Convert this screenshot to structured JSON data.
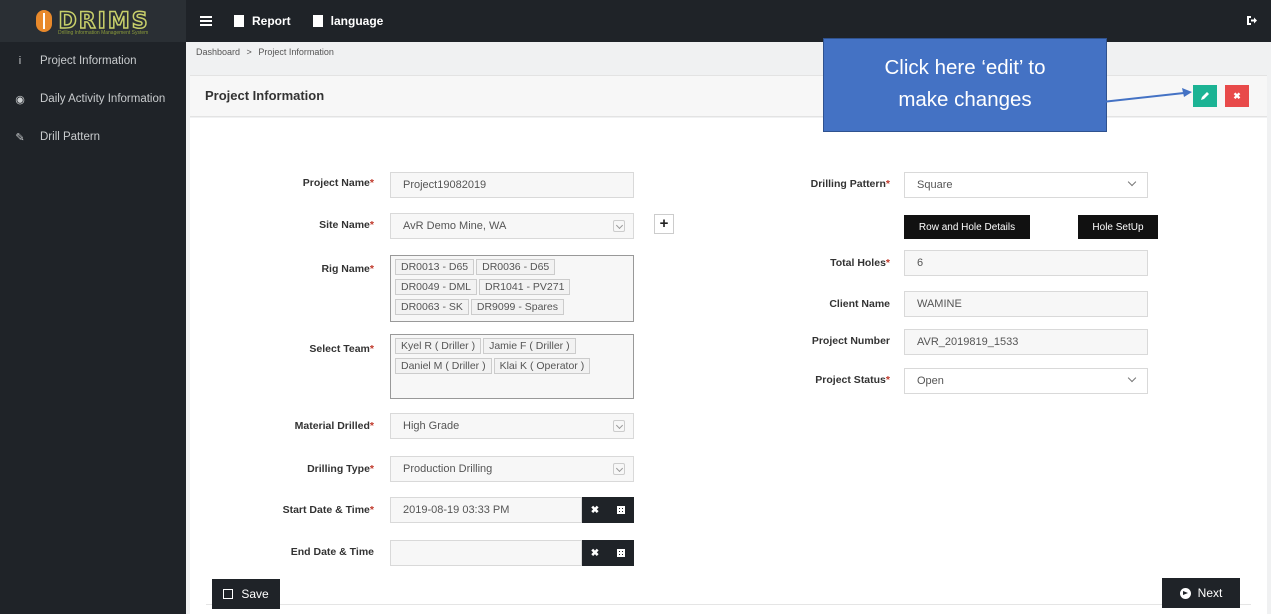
{
  "app": {
    "logo": "DRIMS",
    "logo_sub": "Drilling Information Management System"
  },
  "topnav": {
    "items": [
      {
        "label": "Report"
      },
      {
        "label": "language"
      }
    ]
  },
  "sidebar": {
    "items": [
      {
        "label": "Project Information",
        "icon": "info-icon"
      },
      {
        "label": "Daily Activity Information",
        "icon": "eye-icon"
      },
      {
        "label": "Drill Pattern",
        "icon": "pencil-icon"
      }
    ]
  },
  "breadcrumb": {
    "home": "Dashboard",
    "sep": ">",
    "current": "Project Information"
  },
  "panel": {
    "title": "Project Information"
  },
  "form": {
    "project_name": {
      "label": "Project Name",
      "value": "Project19082019"
    },
    "site_name": {
      "label": "Site Name",
      "value": "AvR Demo Mine, WA"
    },
    "rig_name": {
      "label": "Rig Name",
      "tags": [
        "DR0013 - D65",
        "DR0036 - D65",
        "DR0049 - DML",
        "DR1041 - PV271",
        "DR0063 - SK",
        "DR9099 - Spares"
      ]
    },
    "select_team": {
      "label": "Select Team",
      "tags": [
        "Kyel R ( Driller )",
        "Jamie F ( Driller )",
        "Daniel M ( Driller )",
        "Klai K ( Operator )"
      ]
    },
    "material_drilled": {
      "label": "Material Drilled",
      "value": "High Grade"
    },
    "drilling_type": {
      "label": "Drilling Type",
      "value": "Production Drilling"
    },
    "start_datetime": {
      "label": "Start Date & Time",
      "value": "2019-08-19 03:33 PM"
    },
    "end_datetime": {
      "label": "End Date & Time",
      "value": ""
    },
    "drilling_pattern": {
      "label": "Drilling Pattern",
      "value": "Square"
    },
    "row_hole_button": "Row and Hole Details",
    "hole_setup_button": "Hole SetUp",
    "total_holes": {
      "label": "Total Holes",
      "value": "6"
    },
    "client_name": {
      "label": "Client Name",
      "value": "WAMINE"
    },
    "project_number": {
      "label": "Project Number",
      "value": "AVR_2019819_1533"
    },
    "project_status": {
      "label": "Project Status",
      "value": "Open"
    },
    "required_mark": "*"
  },
  "footer": {
    "save_label": "Save",
    "next_label": "Next"
  },
  "annotation": {
    "line1": "Click here ‘edit’ to",
    "line2": "make changes"
  },
  "colors": {
    "edit": "#1cb394",
    "delete": "#e84a4a",
    "dark": "#1f2328",
    "callout": "#4472c4"
  }
}
